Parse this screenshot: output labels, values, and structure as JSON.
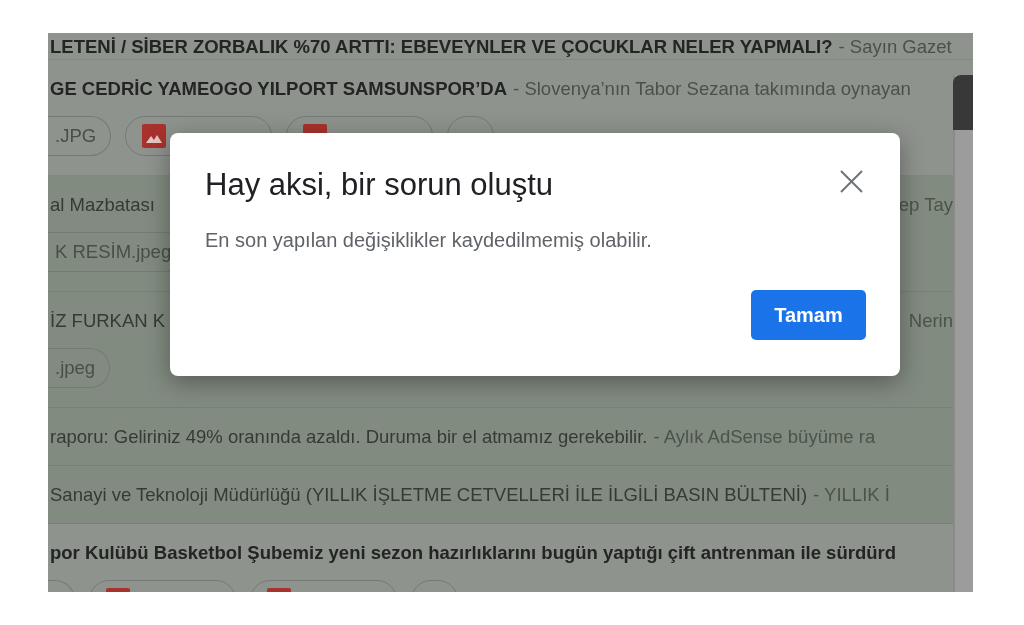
{
  "inbox": {
    "messages": [
      {
        "kind": "plain",
        "unread": true,
        "subject": "LETENİ / SİBER ZORBALIK %70 ARTTI: EBEVEYNLER VE ÇOCUKLAR NELER YAPMALI?",
        "snippet": "- Sayın Gazet"
      },
      {
        "kind": "plain",
        "unread": true,
        "subject": "GE CEDRİC YAMEOGO YILPORT SAMSUNSPOR’DA",
        "snippet": "- Slovenya’nın Tabor Sezana takımında oynayan",
        "attachments": [
          {
            "kind": "file",
            "name": ".JPG"
          },
          {
            "kind": "image"
          },
          {
            "kind": "image"
          },
          {
            "kind": "more"
          }
        ]
      },
      {
        "kind": "covered",
        "unread": false,
        "subject": "al Mazbatası",
        "snippet": "ep Tay",
        "attachments": [
          {
            "kind": "file",
            "name": "K RESİM.jpeg"
          }
        ]
      },
      {
        "kind": "covered",
        "unread": false,
        "subject": "İZ FURKAN K",
        "snippet": "Nerin",
        "attachments": [
          {
            "kind": "file",
            "name": ".jpeg"
          }
        ]
      },
      {
        "kind": "plain",
        "unread": false,
        "subject": "raporu: Geliriniz 49% oranında azaldı. Duruma bir el atmamız gerekebilir.",
        "snippet": "- Aylık AdSense büyüme ra"
      },
      {
        "kind": "plain",
        "unread": false,
        "subject": "Sanayi ve Teknoloji Müdürlüğü (YILLIK İŞLETME CETVELLERİ İLE İLGİLİ BASIN BÜLTENİ)",
        "snippet": "- YILLIK İ"
      },
      {
        "kind": "plain",
        "unread": true,
        "subject": "por Kulübü Basketbol Şubemiz yeni sezon hazırlıklarını bugün yaptığı çift antrenman ile sürdürd",
        "attachments": [
          {
            "kind": "file"
          },
          {
            "kind": "image"
          },
          {
            "kind": "image"
          },
          {
            "kind": "more"
          }
        ]
      }
    ]
  },
  "dialog": {
    "title": "Hay aksi, bir sorun oluştu",
    "message": "En son yapılan değişiklikler kaydedilmemiş olabilir.",
    "buttons": [
      "Tamam"
    ]
  }
}
